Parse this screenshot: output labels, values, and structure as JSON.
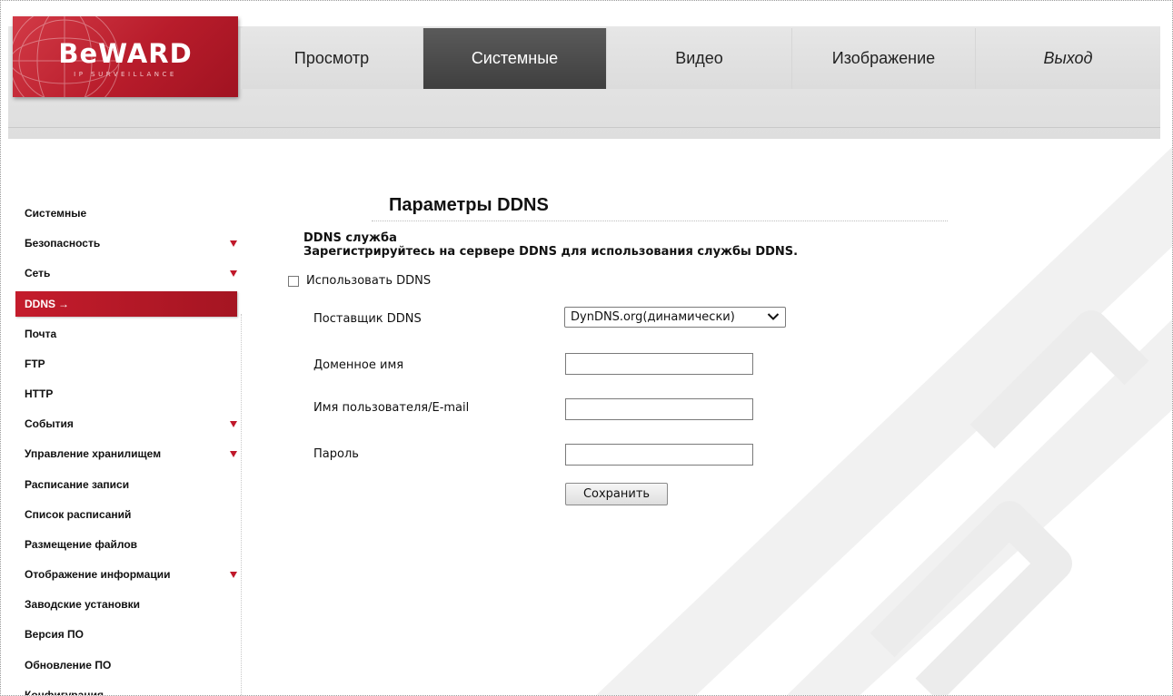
{
  "brand": {
    "logo_text": "BeWARD",
    "logo_subtitle": "IP SURVEILLANCE",
    "accent_color": "#c0182a"
  },
  "top_nav": {
    "items": [
      {
        "label": "Просмотр",
        "active": false
      },
      {
        "label": "Системные",
        "active": true
      },
      {
        "label": "Видео",
        "active": false
      },
      {
        "label": "Изображение",
        "active": false
      },
      {
        "label": "Выход",
        "active": false
      }
    ]
  },
  "sidebar": {
    "items": [
      {
        "label": "Системные",
        "expandable": false,
        "active": false
      },
      {
        "label": "Безопасность",
        "expandable": true,
        "active": false
      },
      {
        "label": "Сеть",
        "expandable": true,
        "active": false
      },
      {
        "label": "DDNS",
        "expandable": false,
        "active": true,
        "active_marker": "→"
      },
      {
        "label": "Почта",
        "expandable": false,
        "active": false
      },
      {
        "label": "FTP",
        "expandable": false,
        "active": false
      },
      {
        "label": "HTTP",
        "expandable": false,
        "active": false
      },
      {
        "label": "События",
        "expandable": true,
        "active": false
      },
      {
        "label": "Управление хранилищем",
        "expandable": true,
        "active": false
      },
      {
        "label": "Расписание записи",
        "expandable": false,
        "active": false
      },
      {
        "label": "Список расписаний",
        "expandable": false,
        "active": false
      },
      {
        "label": "Размещение файлов",
        "expandable": false,
        "active": false
      },
      {
        "label": "Отображение информации",
        "expandable": true,
        "active": false
      },
      {
        "label": "Заводские установки",
        "expandable": false,
        "active": false
      },
      {
        "label": "Версия ПО",
        "expandable": false,
        "active": false
      },
      {
        "label": "Обновление ПО",
        "expandable": false,
        "active": false
      },
      {
        "label": "Конфигурация",
        "expandable": false,
        "active": false
      }
    ]
  },
  "content": {
    "title": "Параметры DDNS",
    "section_title": "DDNS служба",
    "section_hint": "Зарегистрируйтесь на сервере DDNS для использования службы DDNS.",
    "use_ddns_label": "Использовать DDNS",
    "use_ddns_checked": false,
    "provider": {
      "label": "Поставщик DDNS",
      "value": "DynDNS.org(динамически)"
    },
    "domain": {
      "label": "Доменное имя",
      "value": ""
    },
    "username": {
      "label": "Имя пользователя/E-mail",
      "value": ""
    },
    "password": {
      "label": "Пароль",
      "value": ""
    },
    "save_label": "Сохранить"
  }
}
